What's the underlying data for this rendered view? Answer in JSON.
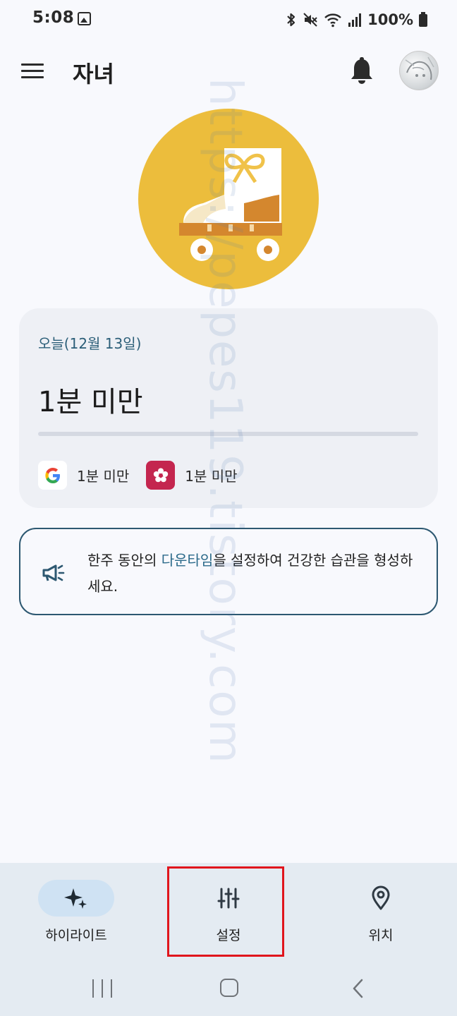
{
  "status_bar": {
    "time": "5:08",
    "battery": "100%"
  },
  "app_bar": {
    "title": "자녀"
  },
  "usage": {
    "date": "오늘(12월 13일)",
    "total": "1분 미만",
    "progress": 0,
    "apps": [
      {
        "icon": "google-icon",
        "time": "1분 미만"
      },
      {
        "icon": "flower-icon",
        "time": "1분 미만"
      }
    ]
  },
  "tip": {
    "prefix": "한주 동안의 ",
    "link": "다운타임",
    "suffix": "을 설정하여 건강한 습관을 형성하세요."
  },
  "bottom_nav": {
    "items": [
      {
        "label": "하이라이트",
        "icon": "sparkle-icon",
        "active": true
      },
      {
        "label": "설정",
        "icon": "sliders-icon",
        "active": false
      },
      {
        "label": "위치",
        "icon": "location-pin-icon",
        "active": false
      }
    ]
  },
  "watermark": "https://pepes119.tistory.com",
  "colors": {
    "accent": "#2b6a8a",
    "hero_circle": "#ecbd3c",
    "highlight_box": "#e0151d",
    "nav_active": "#cfe2f3"
  }
}
